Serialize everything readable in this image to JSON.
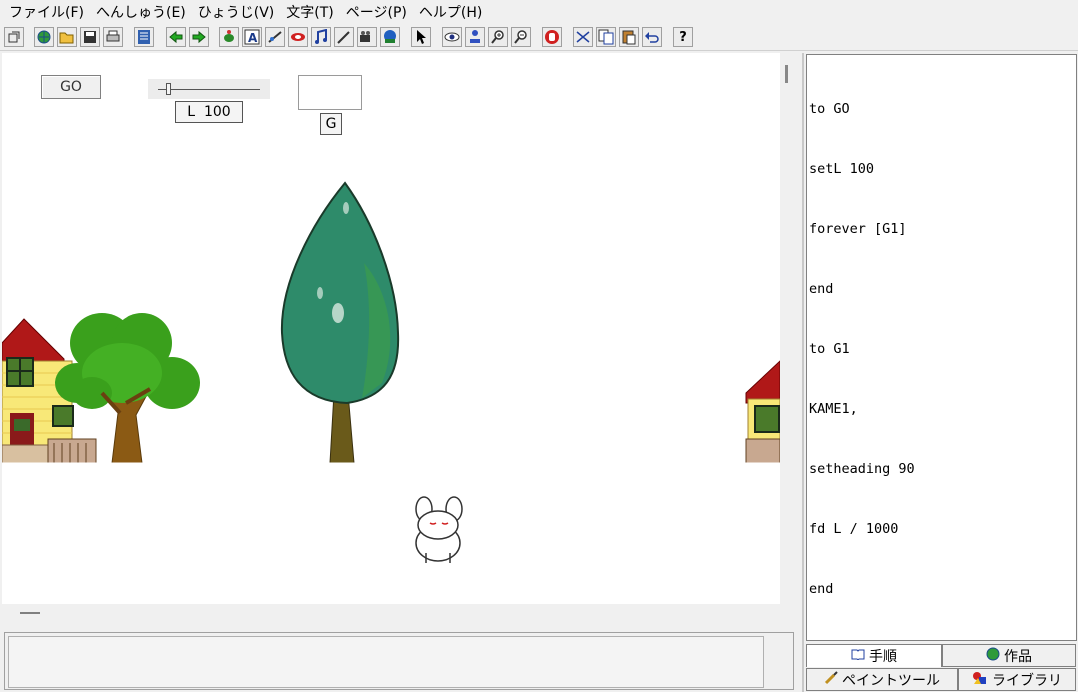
{
  "menubar": {
    "items": [
      "ファイル(F)",
      "へんしゅう(E)",
      "ひょうじ(V)",
      "文字(T)",
      "ページ(P)",
      "ヘルプ(H)"
    ]
  },
  "toolbar": {
    "icons": [
      "restore-icon",
      "globe-icon",
      "open-folder-icon",
      "save-icon",
      "print-icon",
      "page-list-icon",
      "back-arrow-icon",
      "forward-arrow-icon",
      "turtle-icon",
      "text-box-icon",
      "slider-tool-icon",
      "button-tool-icon",
      "music-icon",
      "pen-icon",
      "video-icon",
      "camera-icon",
      "pointer-icon",
      "eye-icon",
      "stamp-icon",
      "zoom-in-icon",
      "zoom-out-icon",
      "stop-hand-icon",
      "scissors-icon",
      "copy-icon",
      "paste-icon",
      "undo-icon",
      "help-icon"
    ],
    "help_label": "?"
  },
  "stage": {
    "go_button": "GO",
    "slider_value": "L  100",
    "slider_level": 0.1,
    "g_button": "G"
  },
  "code": {
    "lines": [
      "to GO",
      "setL 100",
      "forever [G1]",
      "end",
      "to G1",
      "KAME1,",
      "setheading 90",
      "fd L / 1000",
      "end"
    ]
  },
  "tabs": {
    "procedure": "手順",
    "works": "作品",
    "paint": "ペイントツール",
    "library": "ライブラリ"
  },
  "colors": {
    "tree_green": "#2e8b6a",
    "leaf_green": "#3aa01c",
    "trunk_brown": "#8b5a14",
    "house_yellow": "#f8e878",
    "roof_red": "#b01818"
  }
}
